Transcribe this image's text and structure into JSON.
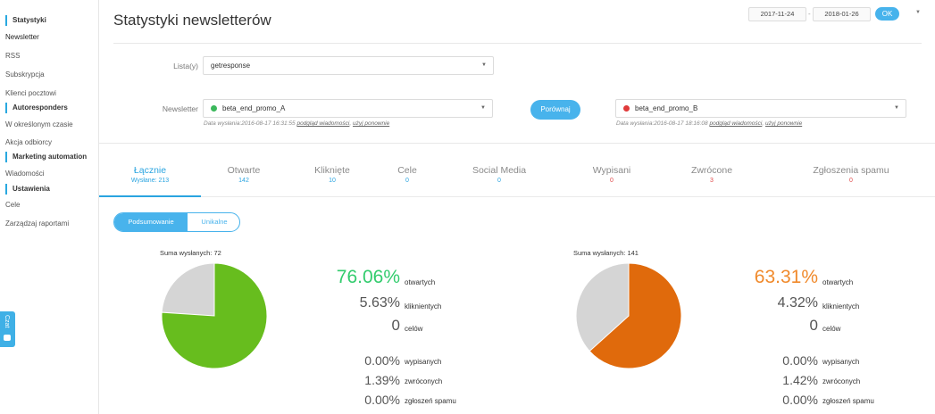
{
  "sidebar": {
    "sections": [
      {
        "title": "Statystyki",
        "items": [
          "Newsletter",
          "RSS",
          "Subskrypcja",
          "Klienci pocztowi"
        ]
      },
      {
        "title": "Autoresponders",
        "items": [
          "W określonym czasie",
          "Akcja odbiorcy"
        ]
      },
      {
        "title": "Marketing automation",
        "items": [
          "Wiadomości"
        ]
      },
      {
        "title": "Ustawienia",
        "items": [
          "Cele",
          "Zarządzaj raportami"
        ]
      }
    ],
    "chat_label": "Czat"
  },
  "header": {
    "title": "Statystyki newsletterów",
    "date_from": "2017-11-24",
    "date_sep": "-",
    "date_to": "2018-01-26",
    "ok_label": "OK"
  },
  "form": {
    "list_label": "Lista(y)",
    "list_value": "getresponse",
    "newsletter_label": "Newsletter",
    "newsletter_a": "beta_end_promo_A",
    "newsletter_a_color": "#3cb85c",
    "meta_a": "Data wysłania:2016-08-17 16:31:55",
    "newsletter_b": "beta_end_promo_B",
    "newsletter_b_color": "#e03a3a",
    "meta_b": "Data wysłania:2016-08-17 18:16:08",
    "link_preview": "podgląd wiadomości",
    "link_reuse": "użyj ponownie",
    "compare_label": "Porównaj"
  },
  "tabs": [
    {
      "label": "Łącznie",
      "sub": "Wysłane: 213",
      "color": "#2aa4e0"
    },
    {
      "label": "Otwarte",
      "sub": "142",
      "color": "#2aa4e0"
    },
    {
      "label": "Kliknięte",
      "sub": "10",
      "color": "#2aa4e0"
    },
    {
      "label": "Cele",
      "sub": "0",
      "color": "#2aa4e0"
    },
    {
      "label": "Social Media",
      "sub": "0",
      "color": "#2aa4e0"
    },
    {
      "label": "Wypisani",
      "sub": "0",
      "color": "#e04a4a"
    },
    {
      "label": "Zwrócone",
      "sub": "3",
      "color": "#e04a4a"
    },
    {
      "label": "Zgłoszenia spamu",
      "sub": "0",
      "color": "#e04a4a"
    }
  ],
  "toggle": {
    "summary": "Podsumowanie",
    "unique": "Unikalne"
  },
  "left": {
    "sum_label": "Suma wysłanych: 72",
    "open_pct": "76.06%",
    "accent": "#33cc6e",
    "pie_color": "#67bd1e",
    "pie_fraction": 0.7606,
    "stats": [
      {
        "value": "5.63%",
        "label": "kliknientych"
      },
      {
        "value": "0",
        "label": "celów"
      },
      {
        "value": "0.00%",
        "label": "wypisanych"
      },
      {
        "value": "1.39%",
        "label": "zwróconych"
      },
      {
        "value": "0.00%",
        "label": "zgłoszeń spamu"
      }
    ],
    "open_label": "otwartych"
  },
  "right": {
    "sum_label": "Suma wysłanych: 141",
    "open_pct": "63.31%",
    "accent": "#f08a2c",
    "pie_color": "#e06a0c",
    "pie_fraction": 0.6331,
    "stats": [
      {
        "value": "4.32%",
        "label": "kliknientych"
      },
      {
        "value": "0",
        "label": "celów"
      },
      {
        "value": "0.00%",
        "label": "wypisanych"
      },
      {
        "value": "1.42%",
        "label": "zwróconych"
      },
      {
        "value": "0.00%",
        "label": "zgłoszeń spamu"
      }
    ],
    "open_label": "otwartych"
  }
}
